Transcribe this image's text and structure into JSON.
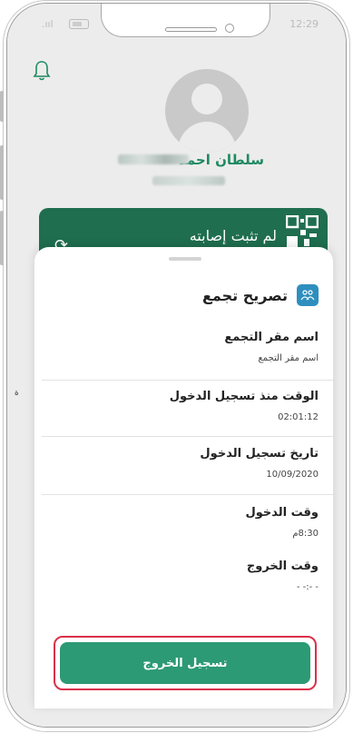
{
  "status_bar": {
    "time": "12:29",
    "signal": ".ııl"
  },
  "profile": {
    "name": "سلطان احمد"
  },
  "card": {
    "status_text": "لم تثبت إصابته"
  },
  "sheet": {
    "title": "تصريح تجمع",
    "fields": [
      {
        "label": "اسم مقر التجمع",
        "value": "اسم مقر التجمع"
      },
      {
        "label": "الوقت منذ تسجيل الدخول",
        "value": "02:01:12"
      },
      {
        "label": "تاريخ تسجيل الدخول",
        "value": "10/09/2020"
      },
      {
        "label": "وقت الدخول",
        "value": "8:30م"
      },
      {
        "label": "وقت الخروج",
        "value": "- -:- -"
      }
    ],
    "logout_button": "تسجيل الخروج"
  },
  "colors": {
    "primary_green": "#2c9a74",
    "card_green": "#1f6e4f",
    "highlight_red": "#d9314a",
    "icon_blue": "#2e8fbe"
  },
  "icons": [
    "bell-icon",
    "avatar-icon",
    "qr-code-icon",
    "refresh-icon",
    "group-icon"
  ]
}
